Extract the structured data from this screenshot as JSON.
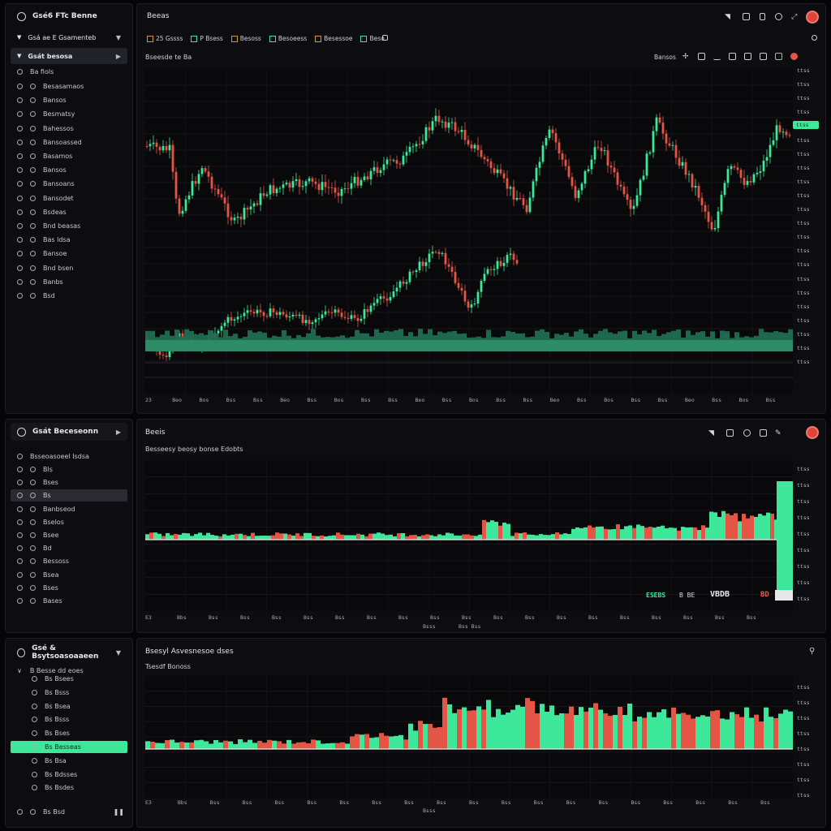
{
  "colors": {
    "up": "#3ee89a",
    "down": "#e55546",
    "bg": "#0d0d11",
    "volume": "#1f7a58"
  },
  "top_sidebar": {
    "title": "Gsé6 FTc Benne",
    "dropdown": "Gsá ae  E Gsamenteb",
    "section": "Gsát besosa",
    "header_row": "Ba fiols",
    "items": [
      "Besasamaos",
      "Bansos",
      "Besmatsy",
      "Bahessos",
      "Bansoassed",
      "Basamos",
      "Bansos",
      "Bansoans",
      "Bansodet",
      "Bsdeas",
      "Bnd beasas",
      "Bas ldsa",
      "Bansoe",
      "Bnd bsen",
      "Banbs",
      "Bsd"
    ]
  },
  "top_panel": {
    "title": "Beeas",
    "tabs": [
      "25 Gssss",
      "P Bsess",
      "Besoss",
      "Besoeess",
      "Besessoe",
      "Beso"
    ],
    "sub": "Bseesde  te Ba",
    "controls_label": "Bansos",
    "ylabels": [
      "ttss",
      "ttss",
      "ttss",
      "ttss",
      "ttss",
      "ttss",
      "ttss",
      "ttss",
      "ttss",
      "ttss",
      "ttss",
      "ttss",
      "ttss",
      "ttss",
      "ttss",
      "ttss",
      "ttss",
      "ttss",
      "ttss",
      "ttss",
      "ttss",
      "ttss"
    ],
    "price_tag": "ttss",
    "xlabels": [
      "23",
      "Beo",
      "Bos",
      "Bss",
      "Bss",
      "Beo",
      "Bss",
      "Bos",
      "Bss",
      "Bss",
      "Beo",
      "Bss",
      "Bos",
      "Bss",
      "Bss",
      "Beo",
      "Bss",
      "Bos",
      "Bss",
      "Bss",
      "Beo",
      "Bss",
      "Bos",
      "Bss"
    ]
  },
  "mid_sidebar": {
    "title": "Gsát Beceseonn",
    "header_row": "Bsseoasoeel  Isdsa",
    "items": [
      "Bls",
      "Bses",
      "Bs",
      "Banbseod",
      "Bselos",
      "Bsee",
      "Bd",
      "Bessoss",
      "Bsea",
      "Bses",
      "Bases"
    ]
  },
  "mid_panel": {
    "title": "Beeis",
    "sub": "Besseesy  beosy  bonse  Edobts",
    "legend": {
      "a": "ESEBS",
      "b": "B  BE",
      "c": "VBDB",
      "d": "BD"
    },
    "ylabels": [
      "ttss",
      "ttss",
      "ttss",
      "ttss",
      "ttss",
      "ttss",
      "ttss",
      "ttss",
      "ttss"
    ],
    "xlabels": [
      "E3",
      "Bbs",
      "Bss",
      "Bss",
      "Bss",
      "Bss",
      "Bss",
      "Bss",
      "Bss",
      "Bss",
      "Bss",
      "Bss",
      "Bss",
      "Bss",
      "Bss",
      "Bss",
      "Bss",
      "Bss",
      "Bss",
      "Bss"
    ],
    "xsub": [
      "Bsss",
      "Bss Bss"
    ]
  },
  "bot_sidebar": {
    "title": "Gsé & Bsytsoasoaaeen",
    "header_row": "B  Besse dd  eoes",
    "items": [
      "Bs Bsees",
      "Bs Bsss",
      "Bs Bsea",
      "Bs Bsss",
      "Bs Bses",
      "Bs Besseas",
      "Bs Bsa",
      "Bs Bdsses",
      "Bs Bsdes"
    ],
    "footer": "Bs  Bsd"
  },
  "bot_panel": {
    "title": "Bsesyl  Asvesnesoe dses",
    "sub": "Tsesdf Bonoss",
    "ylabels": [
      "ttss",
      "ttss",
      "ttss",
      "ttss",
      "ttss",
      "ttss",
      "ttss",
      "ttss"
    ],
    "xlabels": [
      "E3",
      "Bbs",
      "Bss",
      "Bss",
      "Bss",
      "Bss",
      "Bss",
      "Bss",
      "Bss",
      "Bss",
      "Bss",
      "Bss",
      "Bss",
      "Bss",
      "Bss",
      "Bss",
      "Bss",
      "Bss",
      "Bss",
      "Bss"
    ],
    "xsub": "Bsss"
  }
}
